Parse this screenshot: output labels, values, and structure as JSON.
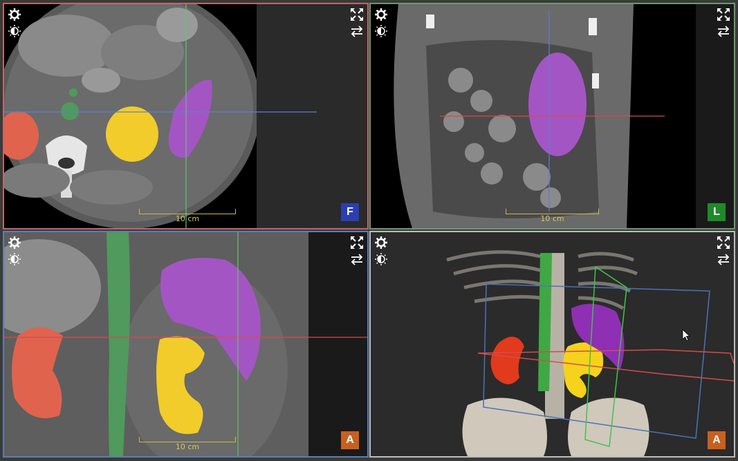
{
  "viewports": {
    "axial": {
      "orientation": "F",
      "scale_label": "10 cm",
      "border_color": "#c4656b",
      "badge_color": "#2a3fb0"
    },
    "sagittal": {
      "orientation": "L",
      "scale_label": "10 cm",
      "border_color": "#6d9a6d",
      "badge_color": "#1f8a2a"
    },
    "coronal": {
      "orientation": "A",
      "scale_label": "10 cm",
      "border_color": "#5a7fb4",
      "badge_color": "#c8601e"
    },
    "volume3d": {
      "orientation": "A",
      "border_color": "#bdbdbd",
      "badge_color": "#c8601e"
    }
  },
  "icons": [
    "settings-icon",
    "contrast-icon",
    "expand-icon",
    "swap-icon"
  ],
  "segment_colors": {
    "right_kidney": "#e0634e",
    "left_kidney": "#f2cc2a",
    "spleen": "#a455c4",
    "vessel": "#4f9a5c"
  }
}
